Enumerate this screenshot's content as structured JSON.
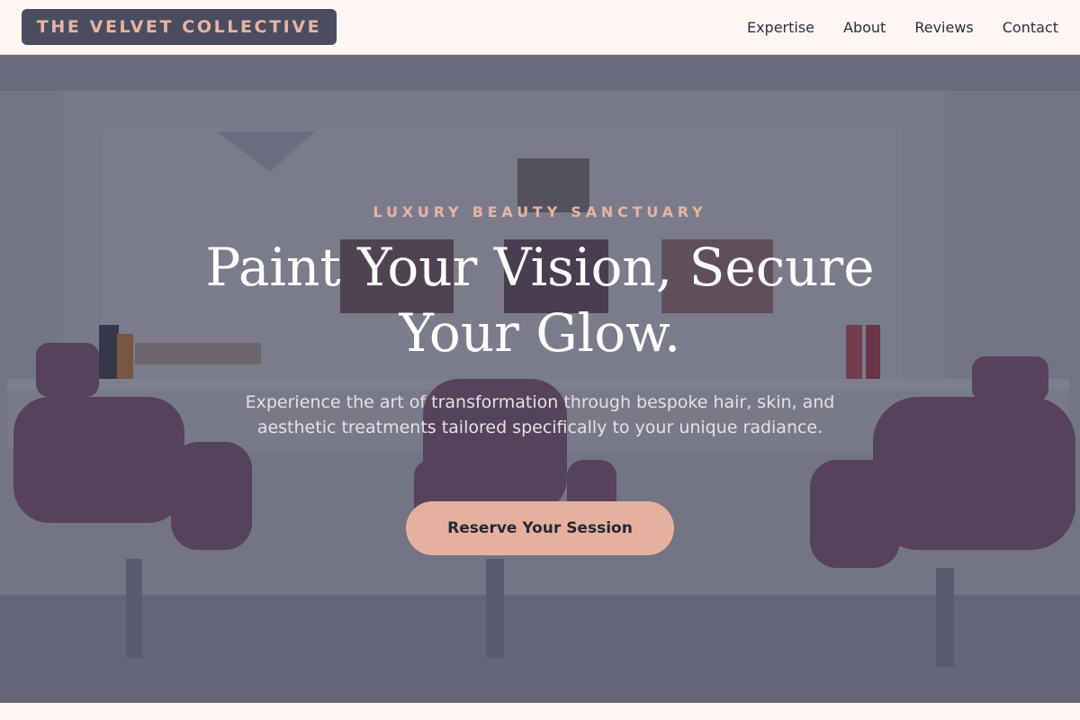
{
  "brand": {
    "name": "THE VELVET COLLECTIVE"
  },
  "nav": {
    "items": [
      {
        "label": "Expertise"
      },
      {
        "label": "About"
      },
      {
        "label": "Reviews"
      },
      {
        "label": "Contact"
      }
    ]
  },
  "hero": {
    "eyebrow": "LUXURY BEAUTY SANCTUARY",
    "headline": "Paint Your Vision, Secure Your Glow.",
    "subtext": "Experience the art of transformation through bespoke hair, skin, and aesthetic treatments tailored specifically to your unique radiance.",
    "cta_label": "Reserve Your Session",
    "background_image": "salon-interior-photo"
  },
  "colors": {
    "accent": "#e6b09f",
    "brand_bg": "#4a4d60",
    "page_bg": "#fdf6f3",
    "overlay": "#34364a"
  }
}
